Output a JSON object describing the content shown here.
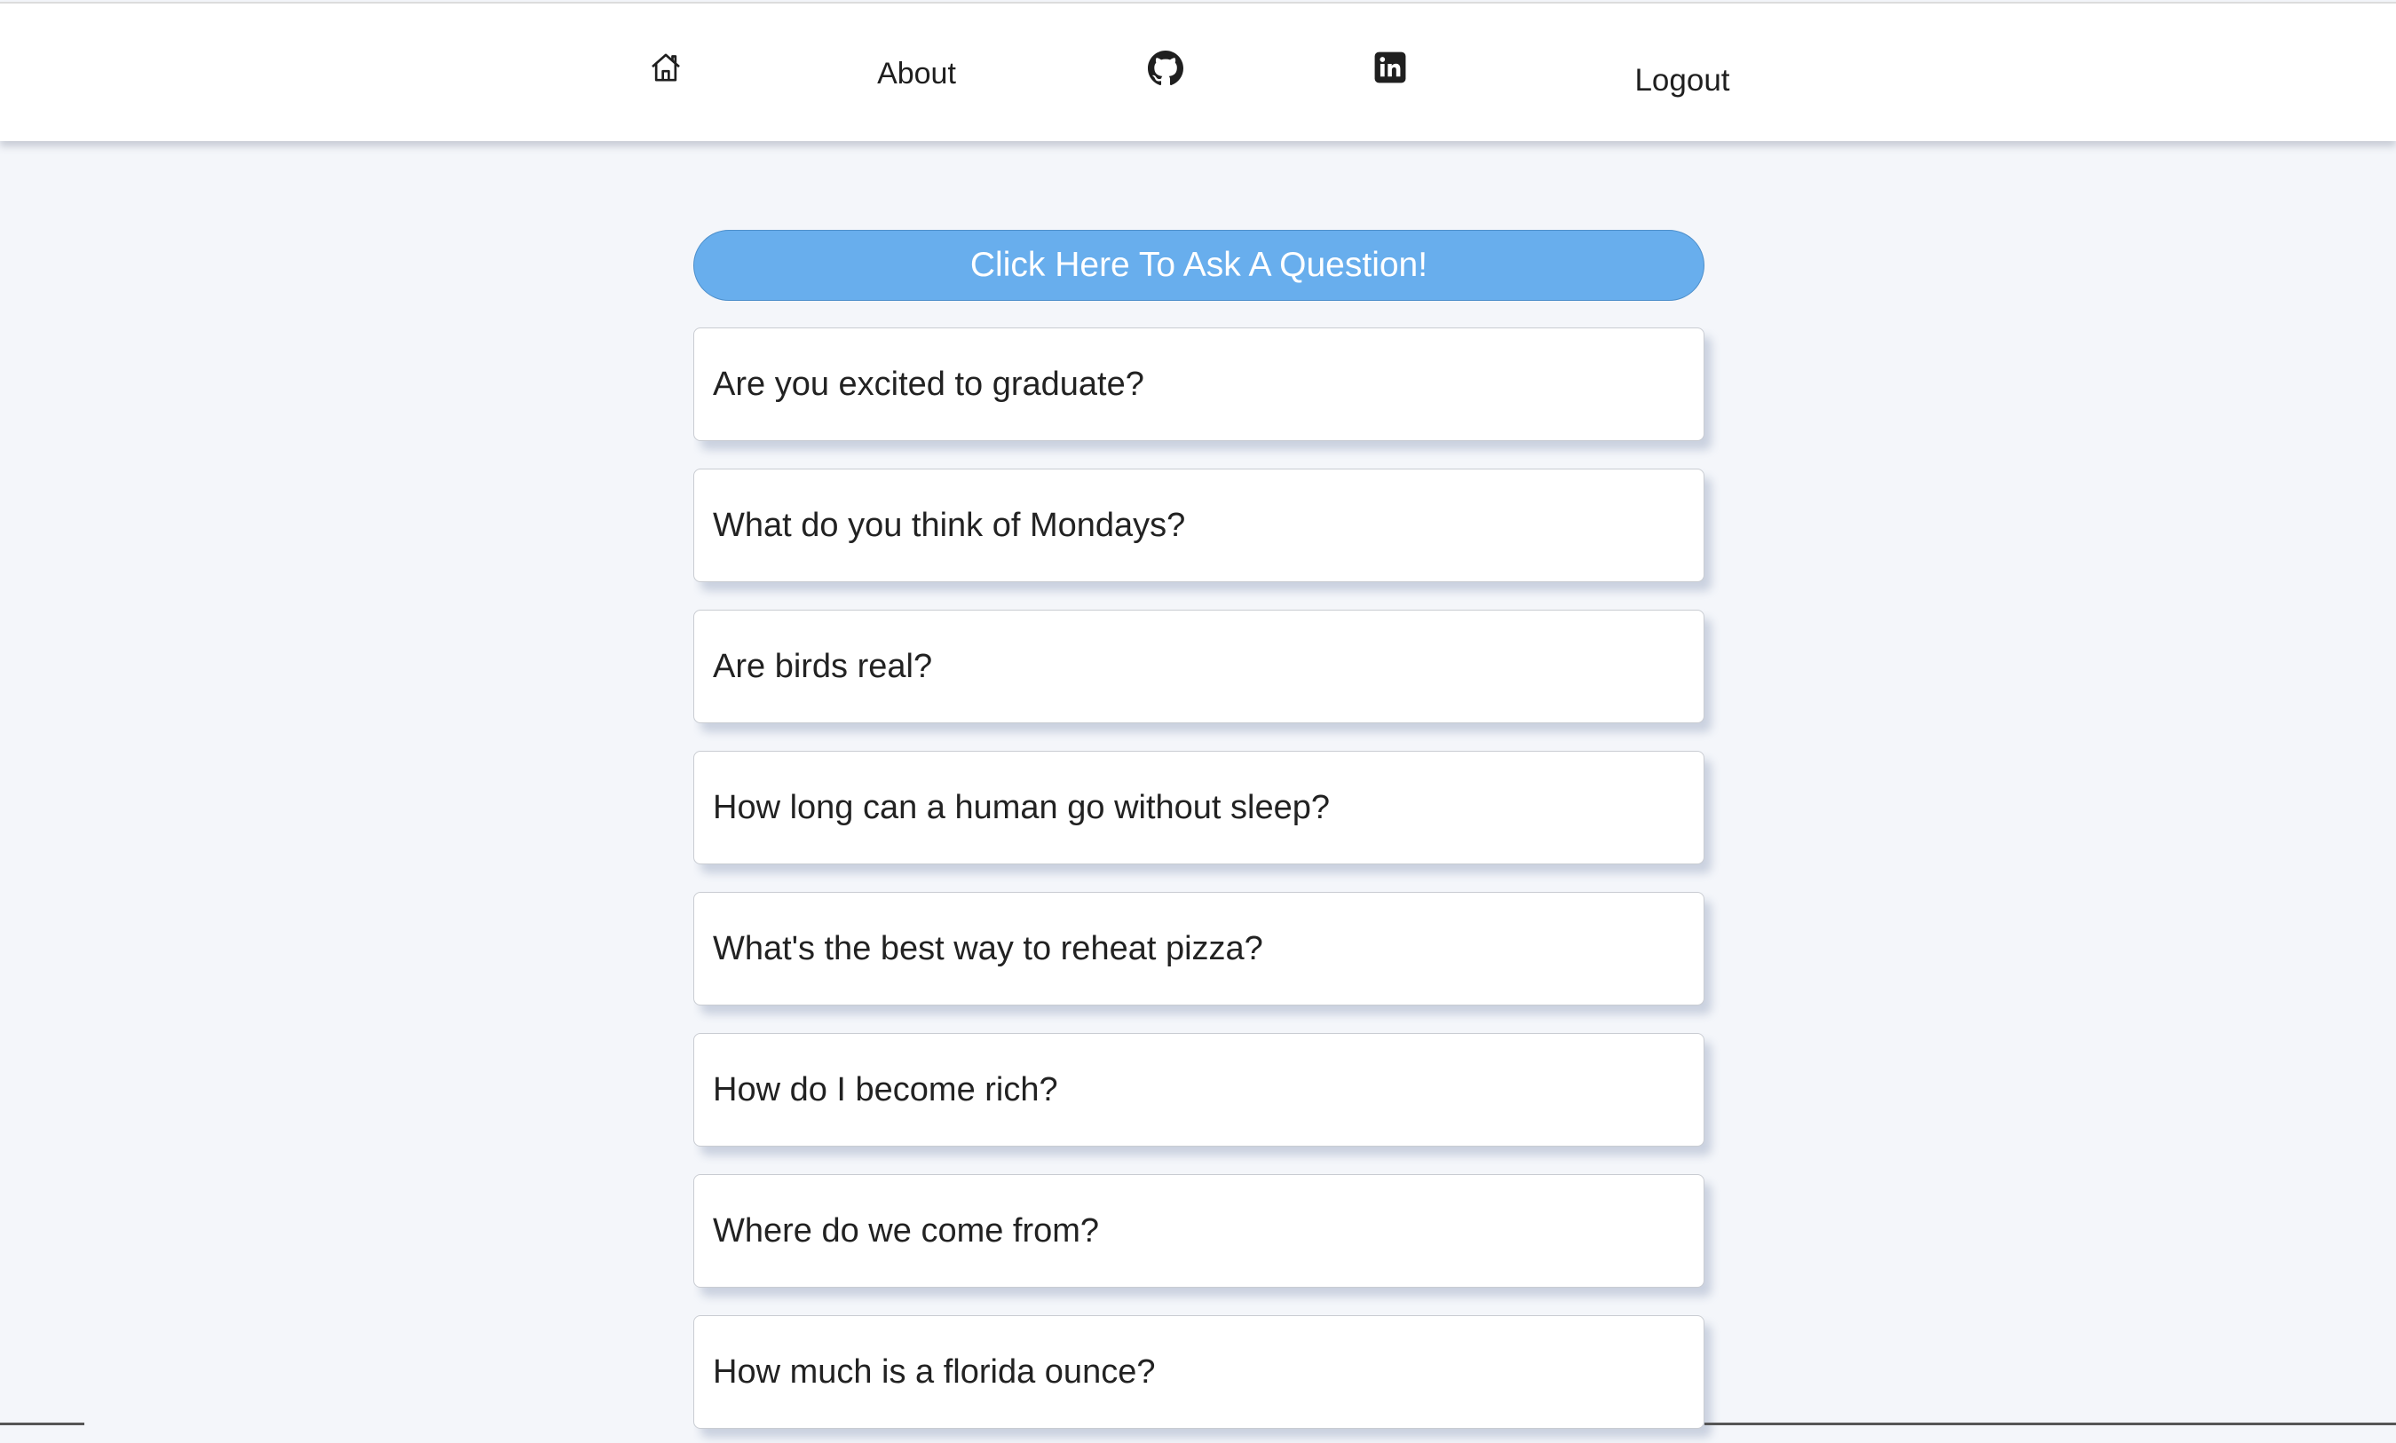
{
  "nav": {
    "home_icon": "home-icon",
    "about_label": "About",
    "github_icon": "github-icon",
    "linkedin_icon": "linkedin-icon",
    "logout_label": "Logout"
  },
  "ask_button": {
    "label": "Click Here To Ask A Question!",
    "color": "#68aeed"
  },
  "questions": [
    {
      "text": "Are you excited to graduate?"
    },
    {
      "text": "What do you think of Mondays?"
    },
    {
      "text": "Are birds real?"
    },
    {
      "text": "How long can a human go without sleep?"
    },
    {
      "text": "What's the best way to reheat pizza?"
    },
    {
      "text": "How do I become rich?"
    },
    {
      "text": "Where do we come from?"
    },
    {
      "text": "How much is a florida ounce?"
    }
  ],
  "colors": {
    "background": "#f4f6fa",
    "card": "#ffffff",
    "navbar": "#ffffff"
  }
}
